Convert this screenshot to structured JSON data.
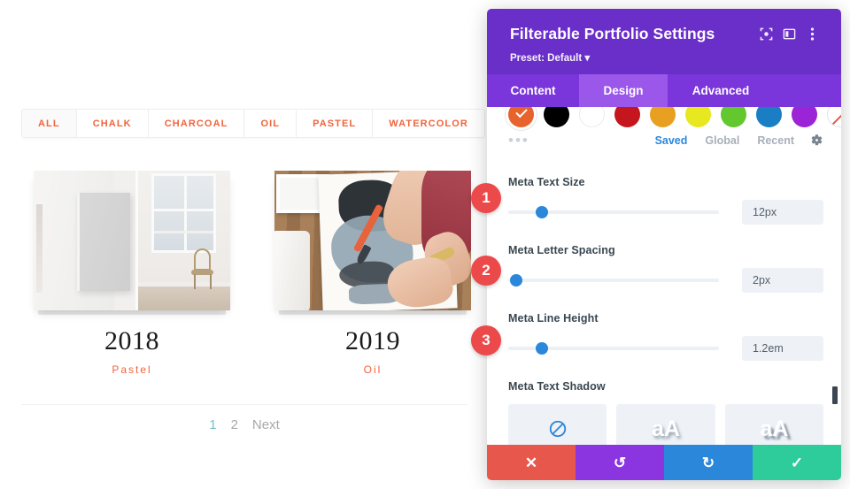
{
  "portfolio": {
    "filters": [
      {
        "label": "ALL",
        "active": true
      },
      {
        "label": "CHALK",
        "active": false
      },
      {
        "label": "CHARCOAL",
        "active": false
      },
      {
        "label": "OIL",
        "active": false
      },
      {
        "label": "PASTEL",
        "active": false
      },
      {
        "label": "WATERCOLOR",
        "active": false
      }
    ],
    "items": [
      {
        "title": "2018",
        "meta": "Pastel",
        "image": "white-canvas-in-studio-with-window-and-chair"
      },
      {
        "title": "2019",
        "meta": "Oil",
        "image": "person-painting-with-brush-on-paper"
      }
    ],
    "pagination": {
      "pages": [
        {
          "label": "1",
          "current": true
        },
        {
          "label": "2",
          "current": false
        },
        {
          "label": "Next",
          "current": false
        }
      ]
    },
    "colors": {
      "accent": "#f0643c",
      "pagination_current": "#74c3c4"
    }
  },
  "modal": {
    "title": "Filterable Portfolio Settings",
    "preset": "Preset: Default",
    "header_icons": [
      {
        "name": "focus-icon",
        "glyph": "focus"
      },
      {
        "name": "layout-panel-icon",
        "glyph": "panel"
      },
      {
        "name": "more-options-icon",
        "glyph": "kebab"
      }
    ],
    "tabs": [
      {
        "label": "Content",
        "active": false
      },
      {
        "label": "Design",
        "active": true
      },
      {
        "label": "Advanced",
        "active": false
      }
    ],
    "color_picker": {
      "swatches": [
        {
          "color": "#e8622d",
          "selected": true
        },
        {
          "color": "#000000",
          "selected": false
        },
        {
          "color": "#ffffff",
          "selected": false
        },
        {
          "color": "#c4161c",
          "selected": false
        },
        {
          "color": "#e8a020",
          "selected": false
        },
        {
          "color": "#e8e820",
          "selected": false
        },
        {
          "color": "#63c82d",
          "selected": false
        },
        {
          "color": "#1a7ec4",
          "selected": false
        },
        {
          "color": "#9b24d6",
          "selected": false
        },
        {
          "color": "#ffffff",
          "selected": false,
          "empty": true
        }
      ],
      "more_dots": "•••",
      "tabs": [
        {
          "label": "Saved",
          "active": true
        },
        {
          "label": "Global",
          "active": false
        },
        {
          "label": "Recent",
          "active": false
        }
      ],
      "gear_icon": "gear-icon",
      "active_color": "#2b87da"
    },
    "fields": [
      {
        "label": "Meta Text Size",
        "value": "12px",
        "slider_percent": 13,
        "badge": "1"
      },
      {
        "label": "Meta Letter Spacing",
        "value": "2px",
        "slider_percent": 4,
        "badge": "2"
      },
      {
        "label": "Meta Line Height",
        "value": "1.2em",
        "slider_percent": 13,
        "badge": "3"
      }
    ],
    "shadow": {
      "label": "Meta Text Shadow",
      "options": [
        {
          "name": "no-shadow",
          "glyph": "⊘",
          "selected": true
        },
        {
          "name": "shadow-soft",
          "glyph": "aA",
          "selected": false
        },
        {
          "name": "shadow-strong",
          "glyph": "aA",
          "selected": false
        }
      ]
    },
    "footer": [
      {
        "name": "cancel-button",
        "glyph": "✕",
        "color": "#e8574c"
      },
      {
        "name": "undo-button",
        "glyph": "↺",
        "color": "#8b35e0"
      },
      {
        "name": "redo-button",
        "glyph": "↻",
        "color": "#2b87da"
      },
      {
        "name": "save-button",
        "glyph": "✓",
        "color": "#2ecb9b"
      }
    ],
    "colors": {
      "header_purple": "#6b2fc9",
      "tabbar_purple": "#7a35db",
      "active_tab_purple": "#9a57ea"
    }
  },
  "annotations": [
    {
      "number": "1"
    },
    {
      "number": "2"
    },
    {
      "number": "3"
    }
  ]
}
